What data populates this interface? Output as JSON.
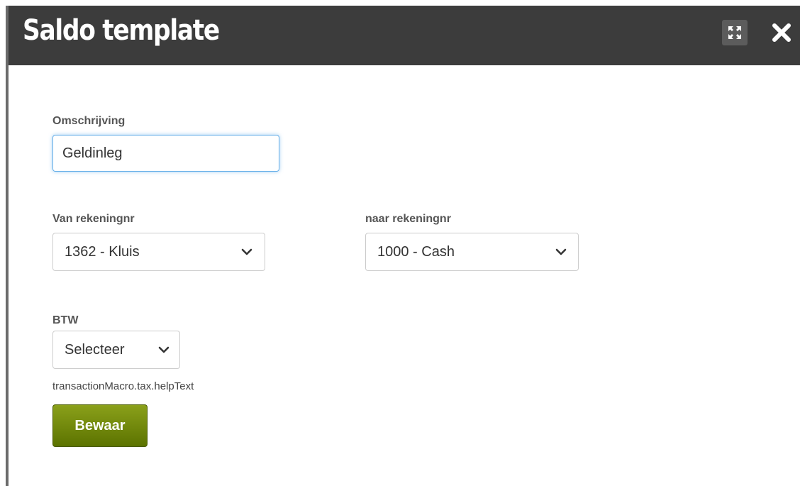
{
  "dialog": {
    "title": "Saldo template",
    "maximize_icon": "maximize-icon",
    "close_icon": "close-icon"
  },
  "form": {
    "description": {
      "label": "Omschrijving",
      "value": "Geldinleg"
    },
    "from_account": {
      "label": "Van rekeningnr",
      "selected": "1362 - Kluis"
    },
    "to_account": {
      "label": "naar rekeningnr",
      "selected": "1000 - Cash"
    },
    "tax": {
      "label": "BTW",
      "selected": "Selecteer",
      "help_text": "transactionMacro.tax.helpText"
    },
    "save_label": "Bewaar"
  },
  "colors": {
    "titlebar": "#3c3c3c",
    "save_button": "#6f8a05",
    "focus_border": "#66afe9"
  }
}
